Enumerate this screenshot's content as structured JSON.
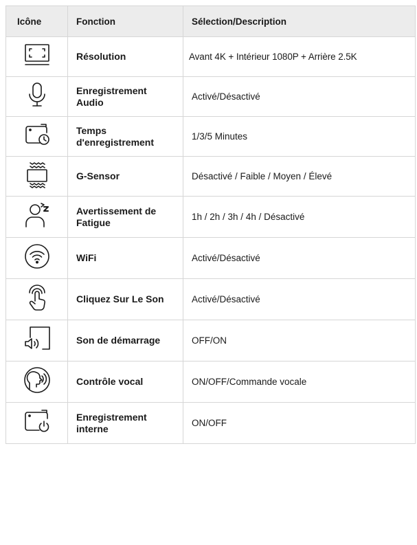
{
  "header": {
    "col_icon": "Icône",
    "col_function": "Fonction",
    "col_description": "Sélection/Description"
  },
  "rows": [
    {
      "icon": "resolution-icon",
      "function": "Résolution",
      "description": "Avant 4K + Intérieur 1080P + Arrière 2.5K"
    },
    {
      "icon": "microphone-icon",
      "function": "Enregistrement Audio",
      "description": "Activé/Désactivé"
    },
    {
      "icon": "camera-timer-icon",
      "function": "Temps d'enregistrement",
      "description": "1/3/5 Minutes"
    },
    {
      "icon": "g-sensor-icon",
      "function": "G-Sensor",
      "description": "Désactivé / Faible / Moyen / Élevé"
    },
    {
      "icon": "fatigue-sleep-icon",
      "function": "Avertissement de Fatigue",
      "description": "1h / 2h / 3h / 4h / Désactivé"
    },
    {
      "icon": "wifi-icon",
      "function": "WiFi",
      "description": "Activé/Désactivé"
    },
    {
      "icon": "touch-tap-icon",
      "function": "Cliquez Sur Le Son",
      "description": "Activé/Désactivé"
    },
    {
      "icon": "startup-sound-icon",
      "function": "Son de démarrage",
      "description": "OFF/ON"
    },
    {
      "icon": "voice-control-icon",
      "function": "Contrôle vocal",
      "description": "ON/OFF/Commande vocale"
    },
    {
      "icon": "camera-power-icon",
      "function": "Enregistrement interne",
      "description": "ON/OFF"
    }
  ]
}
